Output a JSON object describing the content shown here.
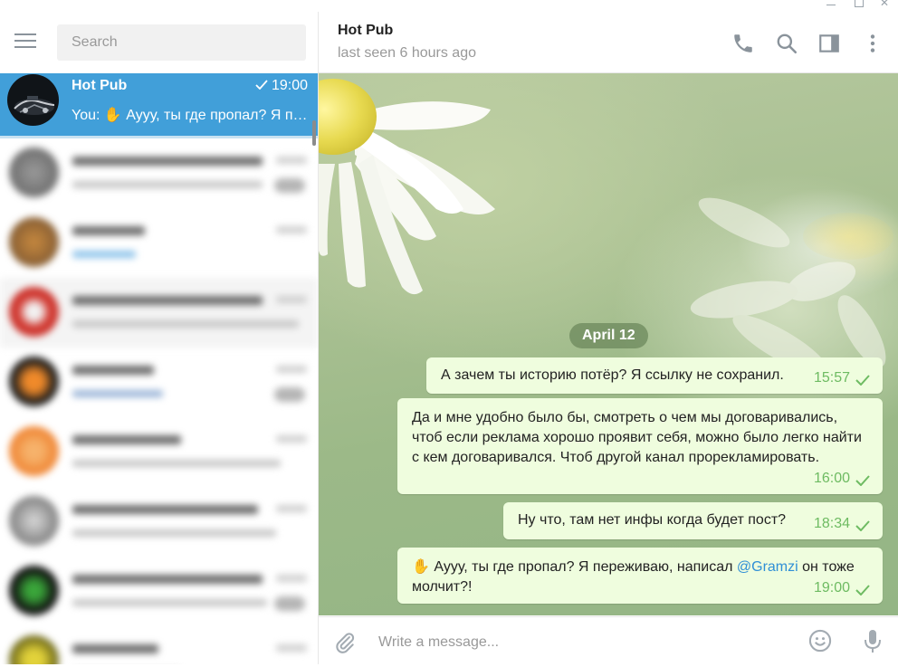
{
  "search": {
    "placeholder": "Search"
  },
  "active_chat": {
    "title": "Hot Pub",
    "time": "19:00",
    "preview": "You: ✋ Аууу, ты где пропал? Я переживаю, написал @Gramzi он тоже молчит?!"
  },
  "header": {
    "title": "Hot Pub",
    "status": "last seen 6 hours ago",
    "icons": [
      "phone-icon",
      "search-icon",
      "sidebar-toggle-icon",
      "more-vertical-icon"
    ]
  },
  "date_chip": "April 12",
  "messages": [
    {
      "text": "А зачем ты историю потёр? Я ссылку не сохранил.",
      "time": "15:57"
    },
    {
      "text": "Да и мне удобно было бы, смотреть о чем мы договаривались, чтоб если реклама хорошо проявит себя, можно было легко найти с кем договаривался. Чтоб другой канал прорекламировать.",
      "time": "16:00"
    },
    {
      "text": "Ну что, там нет инфы когда будет пост?",
      "time": "18:34"
    },
    {
      "text_before": "✋ Аууу, ты где пропал? Я переживаю, написал ",
      "mention": "@Gramzi",
      "text_after": " он тоже молчит?!",
      "time": "19:00"
    }
  ],
  "composer": {
    "placeholder": "Write a message..."
  },
  "colors": {
    "accent": "#419fd9",
    "bubble_out": "#effdde",
    "time_out": "#6ebb62",
    "mention": "#2f8fd6"
  }
}
